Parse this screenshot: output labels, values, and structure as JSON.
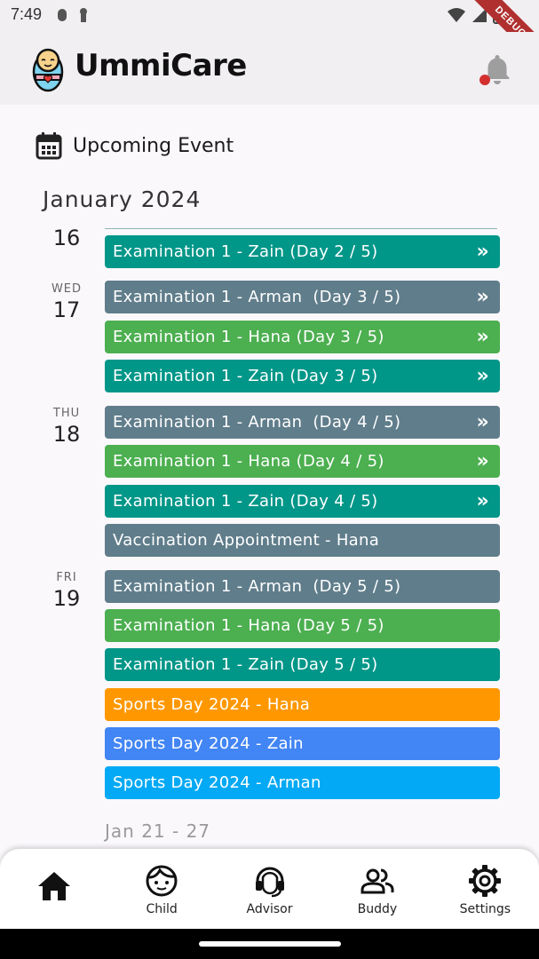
{
  "status_bar": {
    "time": "7:49",
    "debug_label": "DEBUG"
  },
  "app": {
    "title": "UmmiCare"
  },
  "section": {
    "title": "Upcoming Event",
    "month": "January 2024"
  },
  "days": [
    {
      "weekday": "",
      "day": "16"
    },
    {
      "weekday": "WED",
      "day": "17"
    },
    {
      "weekday": "THU",
      "day": "18"
    },
    {
      "weekday": "FRI",
      "day": "19"
    }
  ],
  "events": [
    {
      "label": "Examination 1 - Zain (Day 2 / 5)",
      "color": "#009688",
      "chevron": "»"
    },
    {
      "label": "Examination 1 - Arman  (Day 3 / 5)",
      "color": "#607d8b",
      "chevron": "»"
    },
    {
      "label": "Examination 1 - Hana (Day 3 / 5)",
      "color": "#4caf50",
      "chevron": "»"
    },
    {
      "label": "Examination 1 - Zain (Day 3 / 5)",
      "color": "#009688",
      "chevron": "»"
    },
    {
      "label": "Examination 1 - Arman  (Day 4 / 5)",
      "color": "#607d8b",
      "chevron": "»"
    },
    {
      "label": "Examination 1 - Hana (Day 4 / 5)",
      "color": "#4caf50",
      "chevron": "»"
    },
    {
      "label": "Examination 1 - Zain (Day 4 / 5)",
      "color": "#009688",
      "chevron": "»"
    },
    {
      "label": "Vaccination Appointment - Hana",
      "color": "#607d8b",
      "chevron": ""
    },
    {
      "label": "Examination 1 - Arman  (Day 5 / 5)",
      "color": "#607d8b",
      "chevron": ""
    },
    {
      "label": "Examination 1 - Hana (Day 5 / 5)",
      "color": "#4caf50",
      "chevron": ""
    },
    {
      "label": "Examination 1 - Zain (Day 5 / 5)",
      "color": "#009688",
      "chevron": ""
    },
    {
      "label": "Sports Day 2024 - Hana",
      "color": "#ff9800",
      "chevron": ""
    },
    {
      "label": "Sports Day 2024 - Zain",
      "color": "#4285f4",
      "chevron": ""
    },
    {
      "label": "Sports Day 2024 - Arman",
      "color": "#03a9f4",
      "chevron": ""
    }
  ],
  "week_range": "Jan 21 - 27",
  "nav": [
    {
      "label": "",
      "icon": "home-icon"
    },
    {
      "label": "Child",
      "icon": "child-face-icon"
    },
    {
      "label": "Advisor",
      "icon": "headset-icon"
    },
    {
      "label": "Buddy",
      "icon": "people-icon"
    },
    {
      "label": "Settings",
      "icon": "gear-icon"
    }
  ],
  "colors": {
    "notification_dot": "#d32f2f",
    "bell": "#9e9e9e"
  }
}
